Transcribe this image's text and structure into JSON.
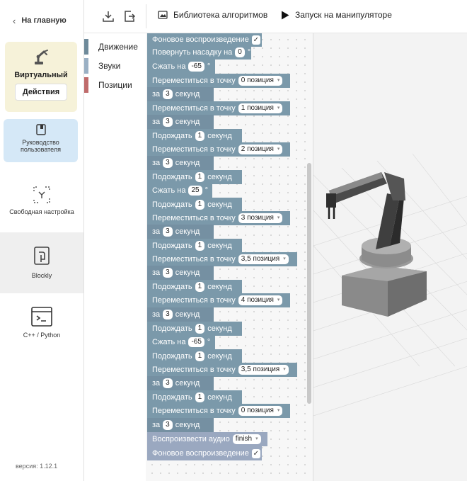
{
  "sidebar": {
    "back_label": "На главную",
    "virtual_title": "Виртуальный",
    "actions_label": "Действия",
    "guide_label_1": "Руководство",
    "guide_label_2": "пользователя",
    "nav": [
      {
        "label": "Свободная настройка",
        "icon": "crosshair-icon"
      },
      {
        "label": "Blockly",
        "icon": "puzzle-icon"
      },
      {
        "label": "C++ / Python",
        "icon": "terminal-icon"
      }
    ],
    "version": "версия: 1.12.1"
  },
  "toolbar": {
    "download_icon": "download-icon",
    "export_icon": "export-icon",
    "library_label": "Библиотека алгоритмов",
    "run_label": "Запуск на манипуляторе"
  },
  "categories": [
    {
      "label": "Движение",
      "color": "#6e8a9a"
    },
    {
      "label": "Звуки",
      "color": "#9ab0c4"
    },
    {
      "label": "Позиции",
      "color": "#bf6b6b"
    }
  ],
  "blocks": {
    "b0": {
      "text": "Фоновое воспроизведение",
      "check": "✓"
    },
    "b1": {
      "pre": "Повернуть насадку на",
      "val": "0",
      "post": "°"
    },
    "b2": {
      "pre": "Сжать на",
      "val": "-65",
      "post": "°"
    },
    "b3": {
      "pre": "Переместиться в точку",
      "val": "0 позиция",
      "pre2": "за",
      "val2": "3",
      "post2": "секунд"
    },
    "b4": {
      "pre": "Переместиться в точку",
      "val": "1 позиция",
      "pre2": "за",
      "val2": "3",
      "post2": "секунд"
    },
    "b5": {
      "pre": "Подождать",
      "val": "1",
      "post": "секунд"
    },
    "b6": {
      "pre": "Переместиться в точку",
      "val": "2 позиция",
      "pre2": "за",
      "val2": "3",
      "post2": "секунд"
    },
    "b7": {
      "pre": "Подождать",
      "val": "1",
      "post": "секунд"
    },
    "b8": {
      "pre": "Сжать на",
      "val": "25",
      "post": "°"
    },
    "b9": {
      "pre": "Подождать",
      "val": "1",
      "post": "секунд"
    },
    "b10": {
      "pre": "Переместиться в точку",
      "val": "3 позиция",
      "pre2": "за",
      "val2": "3",
      "post2": "секунд"
    },
    "b11": {
      "pre": "Подождать",
      "val": "1",
      "post": "секунд"
    },
    "b12": {
      "pre": "Переместиться в точку",
      "val": "3,5 позиция",
      "pre2": "за",
      "val2": "3",
      "post2": "секунд"
    },
    "b13": {
      "pre": "Подождать",
      "val": "1",
      "post": "секунд"
    },
    "b14": {
      "pre": "Переместиться в точку",
      "val": "4 позиция",
      "pre2": "за",
      "val2": "3",
      "post2": "секунд"
    },
    "b15": {
      "pre": "Подождать",
      "val": "1",
      "post": "секунд"
    },
    "b16": {
      "pre": "Сжать на",
      "val": "-65",
      "post": "°"
    },
    "b17": {
      "pre": "Подождать",
      "val": "1",
      "post": "секунд"
    },
    "b18": {
      "pre": "Переместиться в точку",
      "val": "3,5 позиция",
      "pre2": "за",
      "val2": "3",
      "post2": "секунд"
    },
    "b19": {
      "pre": "Подождать",
      "val": "1",
      "post": "секунд"
    },
    "b20": {
      "pre": "Переместиться в точку",
      "val": "0 позиция",
      "pre2": "за",
      "val2": "3",
      "post2": "секунд"
    },
    "b21": {
      "pre": "Воспроизвести аудио",
      "val": "finish"
    },
    "b22": {
      "text": "Фоновое воспроизведение",
      "check": "✓"
    }
  },
  "dropdown_arrow": "▾"
}
